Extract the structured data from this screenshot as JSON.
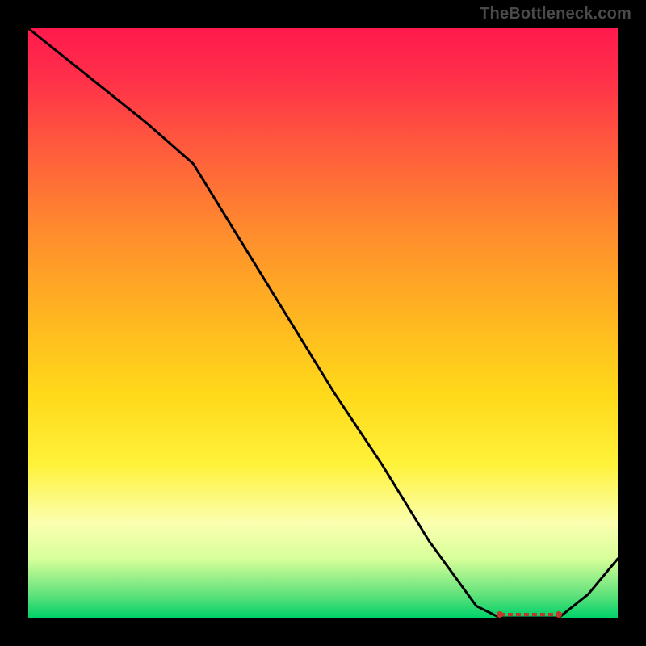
{
  "watermark": "TheBottleneck.com",
  "colors": {
    "curve": "#000000",
    "marker": "#c0392b"
  },
  "chart_data": {
    "type": "line",
    "title": "",
    "xlabel": "",
    "ylabel": "",
    "xlim": [
      0,
      100
    ],
    "ylim": [
      0,
      100
    ],
    "grid": false,
    "legend": false,
    "series": [
      {
        "name": "bottleneck-curve",
        "x": [
          0,
          10,
          20,
          28,
          36,
          44,
          52,
          60,
          68,
          76,
          80,
          82,
          87,
          90,
          95,
          100
        ],
        "values": [
          100,
          92,
          84,
          77,
          64,
          51,
          38,
          26,
          13,
          2,
          0,
          0,
          0,
          0,
          4,
          10
        ]
      }
    ],
    "optimal_band": {
      "x_start": 80,
      "x_end": 90,
      "y": 0
    }
  }
}
